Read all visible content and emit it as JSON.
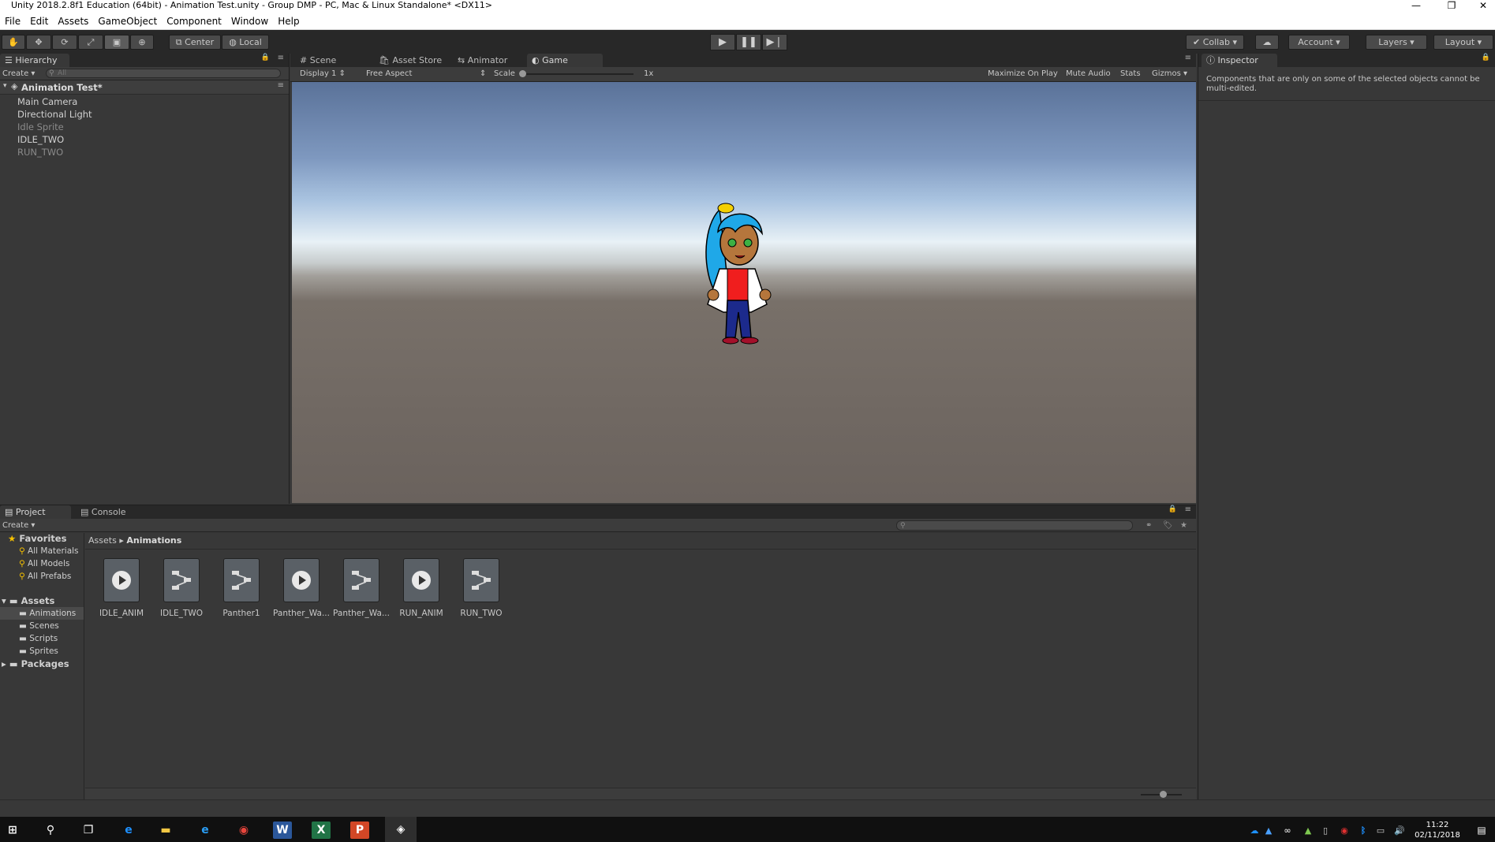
{
  "window": {
    "title": "Unity 2018.2.8f1 Education (64bit) - Animation Test.unity - Group DMP - PC, Mac & Linux Standalone* <DX11>",
    "controls": [
      "—",
      "❐",
      "✕"
    ]
  },
  "menu": [
    "File",
    "Edit",
    "Assets",
    "GameObject",
    "Component",
    "Window",
    "Help"
  ],
  "toolbar": {
    "tools": [
      "hand-icon",
      "move-icon",
      "rotate-icon",
      "scale-icon",
      "rect-icon",
      "transform-icon"
    ],
    "pivot_label": "Center",
    "space_label": "Local",
    "collab_label": "Collab ▾",
    "account_label": "Account",
    "layers_label": "Layers",
    "layout_label": "Layout"
  },
  "hierarchy": {
    "tab": "Hierarchy",
    "create_label": "Create",
    "search_placeholder": "All",
    "scene_name": "Animation Test*",
    "items": [
      {
        "label": "Main Camera",
        "dim": false
      },
      {
        "label": "Directional Light",
        "dim": false
      },
      {
        "label": "Idle Sprite",
        "dim": true
      },
      {
        "label": "IDLE_TWO",
        "dim": false
      },
      {
        "label": "RUN_TWO",
        "dim": true
      }
    ]
  },
  "center_tabs": [
    "Scene",
    "Asset Store",
    "Animator",
    "Game"
  ],
  "game_bar": {
    "display": "Display 1",
    "aspect": "Free Aspect",
    "scale_label": "Scale",
    "scale_value": "1x",
    "maximize": "Maximize On Play",
    "mute": "Mute Audio",
    "stats": "Stats",
    "gizmos": "Gizmos"
  },
  "inspector": {
    "tab": "Inspector",
    "message": "Components that are only on some of the selected objects cannot be multi-edited."
  },
  "project": {
    "tabs": [
      "Project",
      "Console"
    ],
    "create_label": "Create",
    "breadcrumb": [
      "Assets",
      "Animations"
    ],
    "favorites_label": "Favorites",
    "favorites": [
      "All Materials",
      "All Models",
      "All Prefabs"
    ],
    "assets_label": "Assets",
    "folders": [
      "Animations",
      "Scenes",
      "Scripts",
      "Sprites"
    ],
    "packages_label": "Packages",
    "items": [
      {
        "label": "IDLE_ANIM",
        "kind": "play-icon"
      },
      {
        "label": "IDLE_TWO",
        "kind": "controller-icon"
      },
      {
        "label": "Panther1",
        "kind": "controller-icon"
      },
      {
        "label": "Panther_Wa...",
        "kind": "play-icon"
      },
      {
        "label": "Panther_Wa...",
        "kind": "controller-icon"
      },
      {
        "label": "RUN_ANIM",
        "kind": "play-icon"
      },
      {
        "label": "RUN_TWO",
        "kind": "controller-icon"
      }
    ]
  },
  "taskbar": {
    "time": "11:22",
    "date": "02/11/2018"
  }
}
